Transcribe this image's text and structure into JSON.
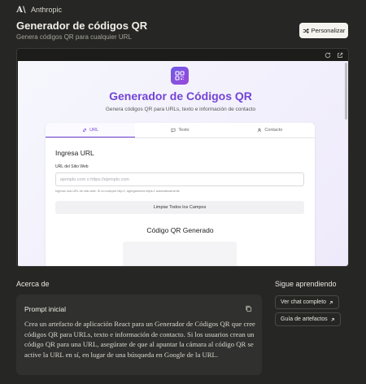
{
  "brand": {
    "name": "Anthropic",
    "logo_letters": "A\\"
  },
  "header": {
    "title": "Generador de códigos QR",
    "subtitle": "Genera códigos QR para cualquier URL",
    "customize_label": "Personalizar"
  },
  "app": {
    "title": "Generador de Códigos QR",
    "subtitle": "Genera códigos QR para URLs, texto e información de contacto",
    "tabs": [
      {
        "label": "URL",
        "active": true,
        "icon": "link-icon"
      },
      {
        "label": "Texto",
        "active": false,
        "icon": "message-icon"
      },
      {
        "label": "Contacto",
        "active": false,
        "icon": "user-icon"
      }
    ],
    "section_title": "Ingresa URL",
    "field_label": "URL del Sitio Web",
    "input_placeholder": "ejemplo.com o https://ejemplo.com",
    "input_value": "",
    "hint": "Ingresa una URL de sitio web. Si no incluyes http://, agregaremos https:// automáticamente",
    "clear_label": "Limpiar Todos los Campos",
    "qr_title": "Código QR Generado"
  },
  "about": {
    "heading": "Acerca de",
    "prompt_title": "Prompt inicial",
    "prompt_text": "Crea un artefacto de aplicación React para un Generador de Códigos QR que cree códigos QR para URLs, texto e información de contacto. Si los usuarios crean un código QR para una URL, asegúrate de que al apuntar la cámara al código QR se active la URL en sí, en lugar de una búsqueda en Google de la URL."
  },
  "learn": {
    "heading": "Sigue aprendiendo",
    "links": [
      {
        "label": "Ver chat completo",
        "icon": "external-arrow-icon"
      },
      {
        "label": "Guía de artefactos",
        "icon": "external-arrow-icon"
      }
    ]
  },
  "colors": {
    "background": "#262624",
    "accent_purple": "#7344d6",
    "card": "#30302e"
  }
}
